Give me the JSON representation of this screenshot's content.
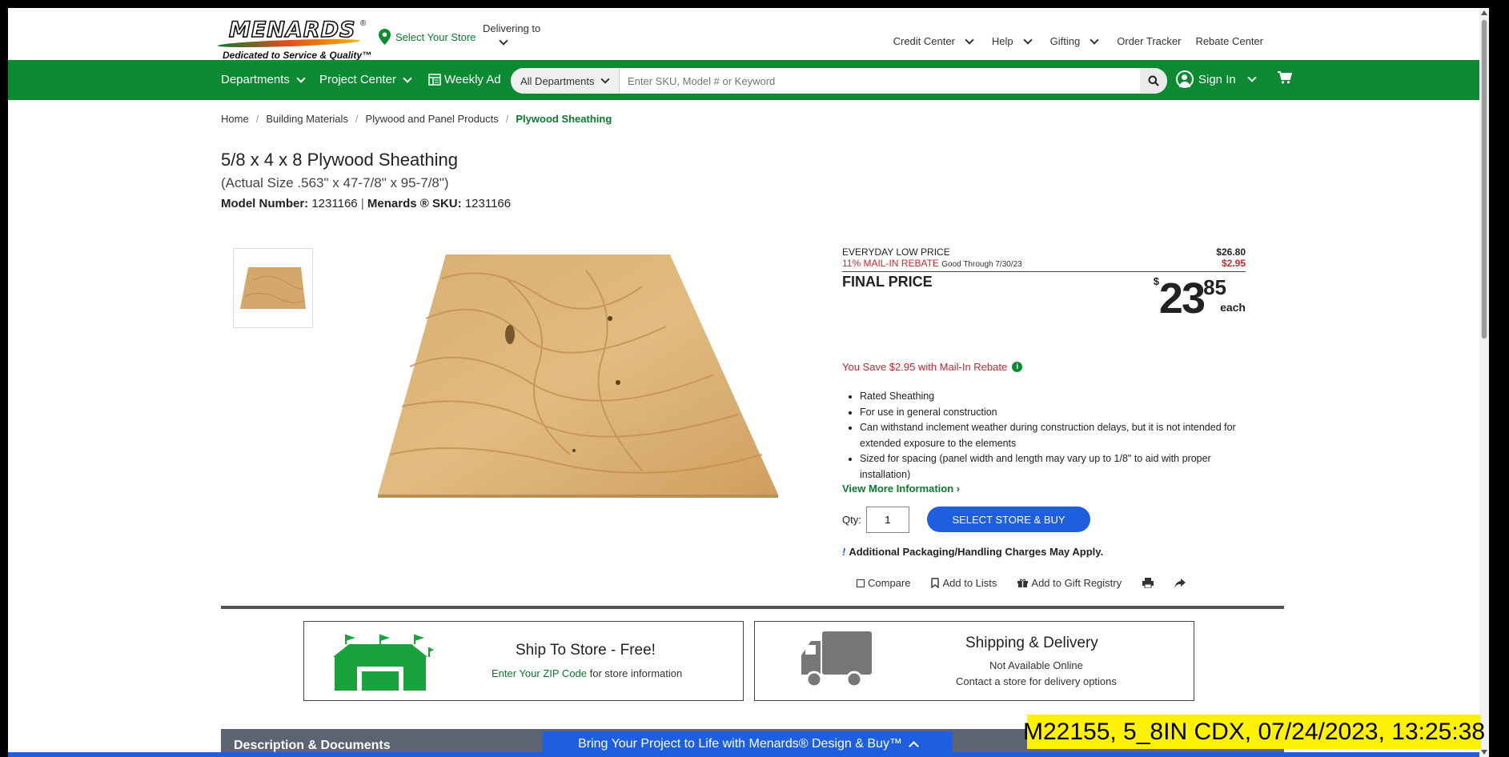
{
  "header": {
    "logo_text": "MENARDS",
    "logo_tagline": "Dedicated to Service & Quality™",
    "select_store": "Select Your Store",
    "delivering_to": "Delivering to",
    "links": [
      "Credit Center",
      "Help",
      "Gifting",
      "Order Tracker",
      "Rebate Center"
    ]
  },
  "nav": {
    "departments": "Departments",
    "project_center": "Project Center",
    "weekly_ad": "Weekly Ad",
    "search_dept": "All Departments",
    "search_placeholder": "Enter SKU, Model # or Keyword",
    "sign_in": "Sign In"
  },
  "breadcrumb": [
    "Home",
    "Building Materials",
    "Plywood and Panel Products",
    "Plywood Sheathing"
  ],
  "product": {
    "title": "5/8 x 4 x 8 Plywood Sheathing",
    "actual_size": "(Actual Size .563\" x 47-7/8\" x 95-7/8\")",
    "model_label": "Model Number:",
    "model": "1231166",
    "sku_label": "Menards ® SKU:",
    "sku": "1231166"
  },
  "pricing": {
    "everyday_label": "EVERYDAY LOW PRICE",
    "everyday_price": "$26.80",
    "rebate_label": "11% MAIL-IN REBATE",
    "rebate_through": "Good Through 7/30/23",
    "rebate_amount": "$2.95",
    "final_label": "FINAL PRICE",
    "final_dollar_sign": "$",
    "final_dollars": "23",
    "final_cents": "85",
    "final_unit": "each",
    "you_save": "You Save $2.95 with Mail-In Rebate"
  },
  "features": [
    "Rated Sheathing",
    "For use in general construction",
    "Can withstand inclement weather during construction delays, but it is not intended for extended exposure to the elements",
    "Sized for spacing (panel width and length may vary up to 1/8\" to aid with proper installation)"
  ],
  "purchase": {
    "view_more": "View More Information",
    "qty_label": "Qty:",
    "qty_value": "1",
    "buy_button": "SELECT STORE & BUY",
    "warning": "Additional Packaging/Handling Charges May Apply.",
    "actions": [
      "Compare",
      "Add to Lists",
      "Add to Gift Registry"
    ]
  },
  "fulfillment": {
    "ship_title": "Ship To Store - Free!",
    "ship_zip_link": "Enter Your ZIP Code",
    "ship_sub": "for store information",
    "delivery_title": "Shipping & Delivery",
    "delivery_line1": "Not Available Online",
    "delivery_line2": "Contact a store for delivery options"
  },
  "bottom": {
    "description_tab": "Description & Documents",
    "promo": "Bring Your Project to Life with Menards® Design & Buy™"
  },
  "stamp": "M22155, 5_8IN CDX, 07/24/2023, 13:25:38",
  "colors": {
    "brand_green": "#0c8a32",
    "buy_blue": "#1d5fe0",
    "rebate_red": "#d1242c"
  }
}
